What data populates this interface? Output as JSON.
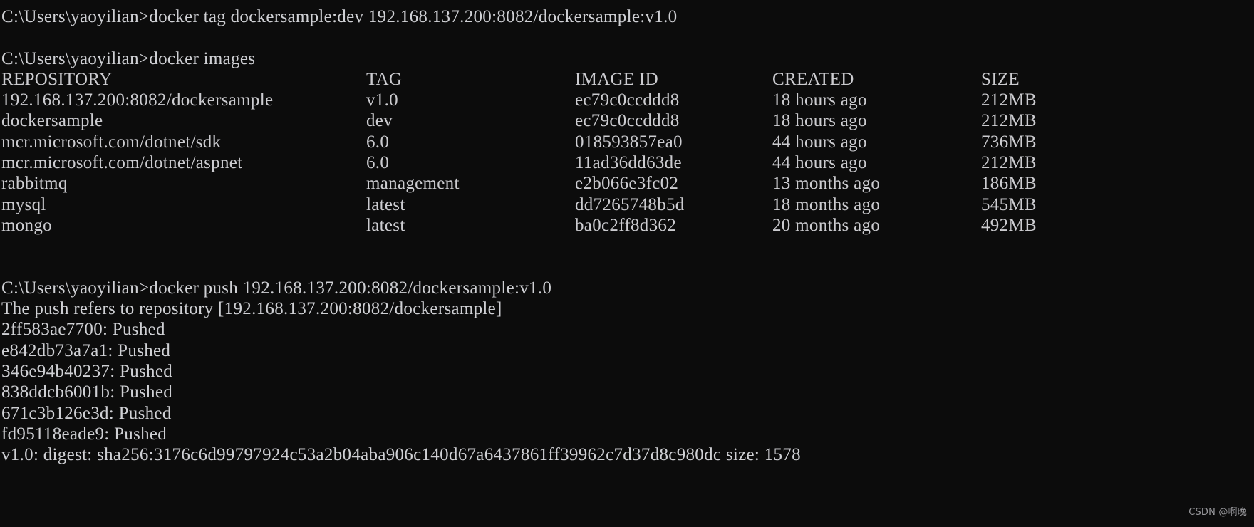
{
  "terminal": {
    "background_color": "#0c0c0c",
    "text_color": "#cccccc",
    "prompt": "C:\\Users\\yaoyilian>",
    "command_tag": "C:\\Users\\yaoyilian>docker tag dockersample:dev 192.168.137.200:8082/dockersample:v1.0",
    "command_images": "C:\\Users\\yaoyilian>docker images",
    "command_push": "C:\\Users\\yaoyilian>docker push 192.168.137.200:8082/dockersample:v1.0",
    "push_refers_line": "The push refers to repository [192.168.137.200:8082/dockersample]",
    "digest_line": "v1.0: digest: sha256:3176c6d99797924c53a2b04aba906c140d67a6437861ff39962c7d37d8c980dc size: 1578"
  },
  "images_table": {
    "headers": {
      "repository": "REPOSITORY",
      "tag": "TAG",
      "image_id": "IMAGE ID",
      "created": "CREATED",
      "size": "SIZE"
    },
    "rows": [
      {
        "repository": "192.168.137.200:8082/dockersample",
        "tag": "v1.0",
        "image_id": "ec79c0ccddd8",
        "created": "18 hours ago",
        "size": "212MB"
      },
      {
        "repository": "dockersample",
        "tag": "dev",
        "image_id": "ec79c0ccddd8",
        "created": "18 hours ago",
        "size": "212MB"
      },
      {
        "repository": "mcr.microsoft.com/dotnet/sdk",
        "tag": "6.0",
        "image_id": "018593857ea0",
        "created": "44 hours ago",
        "size": "736MB"
      },
      {
        "repository": "mcr.microsoft.com/dotnet/aspnet",
        "tag": "6.0",
        "image_id": "11ad36dd63de",
        "created": "44 hours ago",
        "size": "212MB"
      },
      {
        "repository": "rabbitmq",
        "tag": "management",
        "image_id": "e2b066e3fc02",
        "created": "13 months ago",
        "size": "186MB"
      },
      {
        "repository": "mysql",
        "tag": "latest",
        "image_id": "dd7265748b5d",
        "created": "18 months ago",
        "size": "545MB"
      },
      {
        "repository": "mongo",
        "tag": "latest",
        "image_id": "ba0c2ff8d362",
        "created": "20 months ago",
        "size": "492MB"
      }
    ]
  },
  "push_layers": [
    {
      "id": "2ff583ae7700",
      "status": "Pushed",
      "line": "2ff583ae7700: Pushed"
    },
    {
      "id": "e842db73a7a1",
      "status": "Pushed",
      "line": "e842db73a7a1: Pushed"
    },
    {
      "id": "346e94b40237",
      "status": "Pushed",
      "line": "346e94b40237: Pushed"
    },
    {
      "id": "838ddcb6001b",
      "status": "Pushed",
      "line": "838ddcb6001b: Pushed"
    },
    {
      "id": "671c3b126e3d",
      "status": "Pushed",
      "line": "671c3b126e3d: Pushed"
    },
    {
      "id": "fd95118eade9",
      "status": "Pushed",
      "line": "fd95118eade9: Pushed"
    }
  ],
  "watermark": {
    "text": "CSDN @啊晚"
  }
}
